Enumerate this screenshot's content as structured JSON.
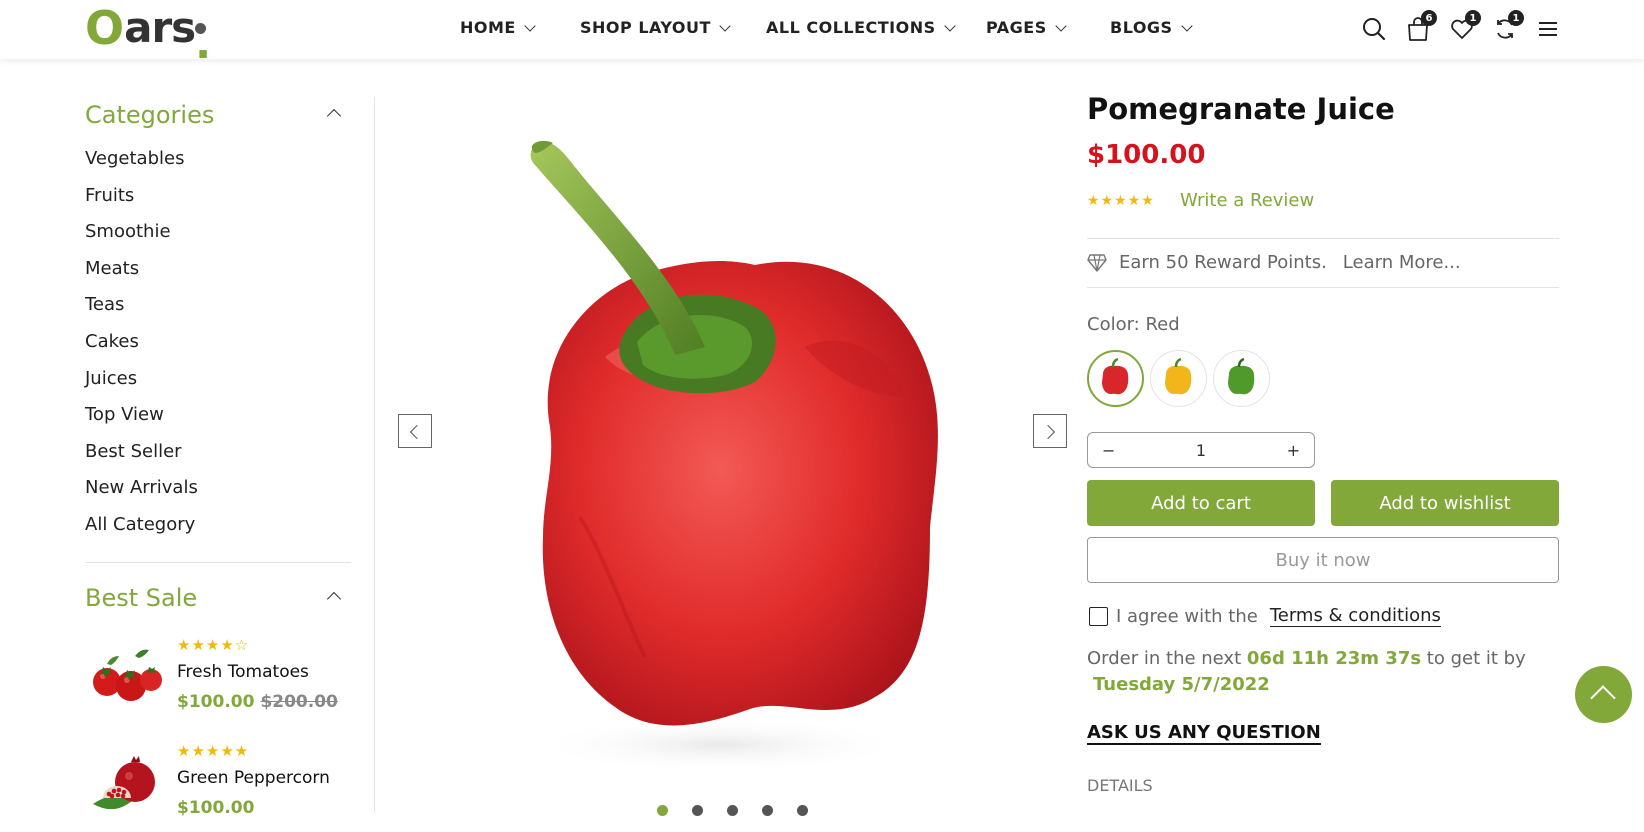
{
  "header": {
    "logo": {
      "first": "O",
      "rest": "ars",
      "dot": "."
    },
    "nav": [
      "HOME",
      "SHOP LAYOUT",
      "ALL COLLECTIONS",
      "PAGES",
      "BLOGS"
    ],
    "icons": {
      "search": "search-icon",
      "cart": {
        "icon": "shopping-bag-icon",
        "count": "6"
      },
      "wishlist": {
        "icon": "heart-icon",
        "count": "1"
      },
      "compare": {
        "icon": "refresh-icon",
        "count": "1"
      },
      "menu": "hamburger-menu-icon"
    }
  },
  "sidebar": {
    "categories_title": "Categories",
    "categories": [
      "Vegetables",
      "Fruits",
      "Smoothie",
      "Meats",
      "Teas",
      "Cakes",
      "Juices",
      "Top View",
      "Best Seller",
      "New Arrivals",
      "All Category"
    ],
    "best_sale_title": "Best Sale",
    "best_sale": [
      {
        "name": "Fresh Tomatoes",
        "price": "$100.00",
        "old_price": "$200.00",
        "rating": 4,
        "stars": "★★★★☆"
      },
      {
        "name": "Green Peppercorn",
        "price": "$100.00",
        "old_price": "",
        "rating": 5,
        "stars": "★★★★★"
      }
    ]
  },
  "gallery": {
    "image": "red-bell-pepper",
    "slides_total": 5,
    "active_slide": 1
  },
  "product": {
    "title": "Pomegranate Juice",
    "price": "$100.00",
    "rating": 5,
    "stars": "★★★★★",
    "write_review": "Write a Review",
    "reward_text": "Earn 50 Reward Points.",
    "reward_link": "Learn More...",
    "color_label": "Color: Red",
    "swatches": [
      "Red",
      "Yellow",
      "Green"
    ],
    "selected_swatch": "Red",
    "quantity": "1",
    "qty_minus": "−",
    "qty_plus": "+",
    "add_to_cart": "Add to cart",
    "add_to_wishlist": "Add to wishlist",
    "buy_now": "Buy it now",
    "agree_text": "I agree with the",
    "terms_link": "Terms & conditions",
    "order_prefix": "Order in the next",
    "order_countdown": "06d 11h 23m 37s",
    "order_suffix": "to get it by",
    "order_date": "Tuesday 5/7/2022",
    "ask_question": "ASK US ANY QUESTION",
    "details_label": "DETAILS"
  },
  "colors": {
    "accent": "#82a83a",
    "price_red": "#d4131e",
    "star": "#f2b90b"
  }
}
